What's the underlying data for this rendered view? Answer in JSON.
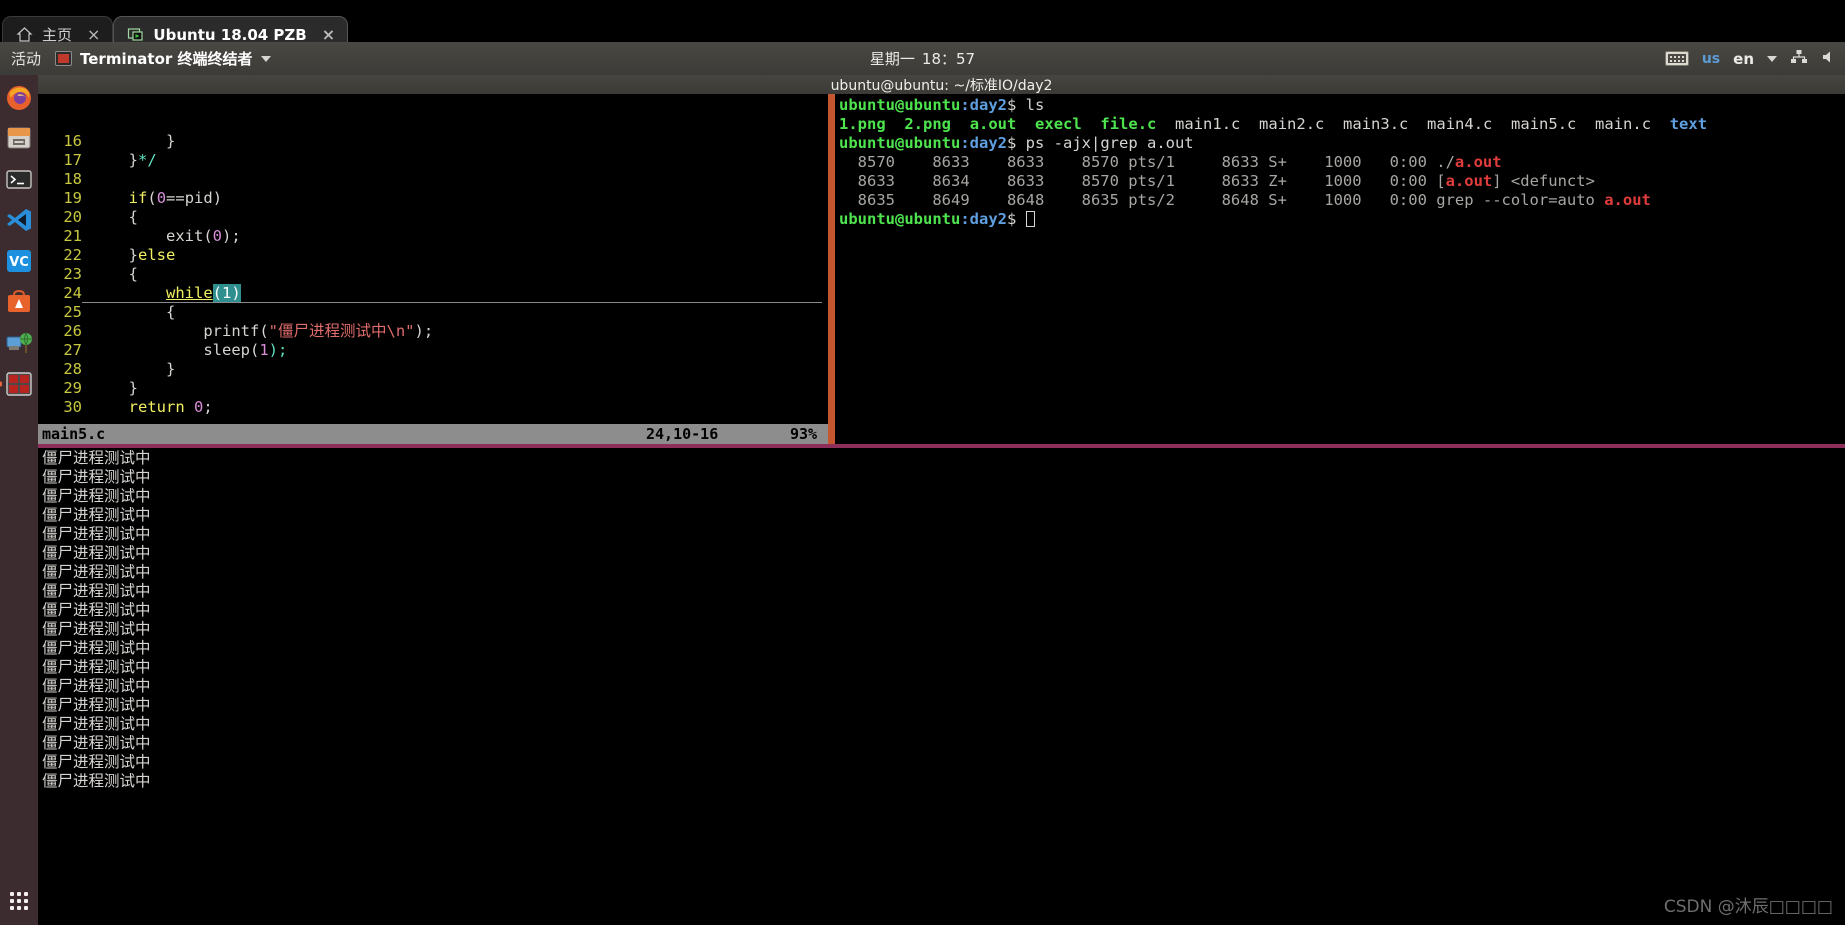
{
  "browser": {
    "tabs": [
      {
        "label": "主页",
        "icon": "home-icon",
        "active": false,
        "close": "×"
      },
      {
        "label": "Ubuntu 18.04 PZB",
        "icon": "vnc-screen-icon",
        "active": true,
        "close": "×"
      }
    ]
  },
  "panel": {
    "activities": "活动",
    "app_menu": "Terminator 终端终结者",
    "app_icon": "terminator-icon",
    "clock_day": "星期一",
    "clock_time": "18：57",
    "keyboard_layout": "us",
    "input_method": "en",
    "icons": [
      "keyboard-icon",
      "network-icon",
      "volume-icon"
    ]
  },
  "dock": {
    "items": [
      {
        "name": "firefox",
        "label": "Firefox",
        "running": false
      },
      {
        "name": "files",
        "label": "Files",
        "running": false
      },
      {
        "name": "terminal",
        "label": "Terminal",
        "running": false
      },
      {
        "name": "vscode",
        "label": "Visual Studio Code",
        "running": false
      },
      {
        "name": "vncviewer",
        "label": "VNC Viewer",
        "running": false
      },
      {
        "name": "software",
        "label": "Ubuntu Software",
        "running": false
      },
      {
        "name": "remmina",
        "label": "Remmina",
        "running": false
      },
      {
        "name": "terminator",
        "label": "Terminator",
        "running": true
      }
    ],
    "show_apps_label": "显示应用程序"
  },
  "window": {
    "title": "ubuntu@ubuntu: ~/标准IO/day2"
  },
  "vim": {
    "lines": [
      {
        "n": "16",
        "segs": [
          {
            "t": "        }",
            "c": "punc"
          }
        ]
      },
      {
        "n": "17",
        "segs": [
          {
            "t": "    }",
            "c": "punc"
          },
          {
            "t": "*/",
            "c": "kw-st"
          }
        ]
      },
      {
        "n": "18",
        "segs": [
          {
            "t": "",
            "c": "punc"
          }
        ]
      },
      {
        "n": "19",
        "segs": [
          {
            "t": "    ",
            "c": "punc"
          },
          {
            "t": "if",
            "c": "kw-ctrl"
          },
          {
            "t": "(",
            "c": "punc"
          },
          {
            "t": "0",
            "c": "num"
          },
          {
            "t": "==pid)",
            "c": "punc"
          }
        ]
      },
      {
        "n": "20",
        "segs": [
          {
            "t": "    {",
            "c": "punc"
          }
        ]
      },
      {
        "n": "21",
        "segs": [
          {
            "t": "        exit(",
            "c": "punc"
          },
          {
            "t": "0",
            "c": "num"
          },
          {
            "t": ");",
            "c": "punc"
          }
        ]
      },
      {
        "n": "22",
        "segs": [
          {
            "t": "    }",
            "c": "punc"
          },
          {
            "t": "else",
            "c": "kw-ctrl"
          }
        ]
      },
      {
        "n": "23",
        "segs": [
          {
            "t": "    {",
            "c": "punc"
          }
        ]
      },
      {
        "n": "24",
        "segs": [
          {
            "t": "        ",
            "c": "punc"
          },
          {
            "t": "while",
            "c": "kw-ctrl kw-under"
          },
          {
            "t": "(",
            "c": "teal-bg"
          },
          {
            "t": "1",
            "c": "teal-bg"
          },
          {
            "t": ")",
            "c": "teal-bg"
          }
        ],
        "cursorline": true
      },
      {
        "n": "25",
        "segs": [
          {
            "t": "        {",
            "c": "punc"
          }
        ]
      },
      {
        "n": "26",
        "segs": [
          {
            "t": "            printf(",
            "c": "punc"
          },
          {
            "t": "\"僵尸进程测试中\\n\"",
            "c": "str"
          },
          {
            "t": ");",
            "c": "punc"
          }
        ]
      },
      {
        "n": "27",
        "segs": [
          {
            "t": "            sleep(",
            "c": "punc"
          },
          {
            "t": "1",
            "c": "num"
          },
          {
            "t": ");",
            "c": "kw-st"
          }
        ]
      },
      {
        "n": "28",
        "segs": [
          {
            "t": "        }",
            "c": "punc"
          }
        ]
      },
      {
        "n": "29",
        "segs": [
          {
            "t": "    }",
            "c": "punc"
          }
        ]
      },
      {
        "n": "30",
        "segs": [
          {
            "t": "    ",
            "c": "punc"
          },
          {
            "t": "return",
            "c": "kw-ctrl"
          },
          {
            "t": " ",
            "c": "punc"
          },
          {
            "t": "0",
            "c": "num"
          },
          {
            "t": ";",
            "c": "punc"
          }
        ]
      }
    ],
    "status": {
      "filename": "main5.c",
      "position": "24,10-16",
      "percent": "93%"
    }
  },
  "shell": {
    "prompt_user": "ubuntu@ubuntu",
    "prompt_path": ":day2",
    "prompt_sym": "$ ",
    "lines": [
      {
        "type": "prompt",
        "cmd": "ls"
      },
      {
        "type": "ls",
        "items": [
          {
            "t": "1.png",
            "c": "t-ls-exec"
          },
          {
            "t": "  ",
            "c": "t-white"
          },
          {
            "t": "2.png",
            "c": "t-ls-exec"
          },
          {
            "t": "  ",
            "c": "t-white"
          },
          {
            "t": "a.out",
            "c": "t-ls-exec"
          },
          {
            "t": "  ",
            "c": "t-white"
          },
          {
            "t": "execl",
            "c": "t-ls-exec"
          },
          {
            "t": "  ",
            "c": "t-white"
          },
          {
            "t": "file.c",
            "c": "t-ls-exec"
          },
          {
            "t": "  ",
            "c": "t-white"
          },
          {
            "t": "main1.c",
            "c": "t-white"
          },
          {
            "t": "  ",
            "c": "t-white"
          },
          {
            "t": "main2.c",
            "c": "t-white"
          },
          {
            "t": "  ",
            "c": "t-white"
          },
          {
            "t": "main3.c",
            "c": "t-white"
          },
          {
            "t": "  ",
            "c": "t-white"
          },
          {
            "t": "main4.c",
            "c": "t-white"
          },
          {
            "t": "  ",
            "c": "t-white"
          },
          {
            "t": "main5.c",
            "c": "t-white"
          },
          {
            "t": "  ",
            "c": "t-white"
          },
          {
            "t": "main.c",
            "c": "t-white"
          },
          {
            "t": "  ",
            "c": "t-white"
          },
          {
            "t": "text",
            "c": "t-ls-dir"
          }
        ]
      },
      {
        "type": "prompt",
        "cmd": "ps -ajx|grep a.out"
      },
      {
        "type": "ps",
        "segs": [
          {
            "t": "  8570    8633    8633    8570 pts/1     8633 S+    1000   0:00 ",
            "c": "t-dim"
          },
          {
            "t": "./",
            "c": "t-dim"
          },
          {
            "t": "a.out",
            "c": "t-red"
          }
        ]
      },
      {
        "type": "ps",
        "segs": [
          {
            "t": "  8633    8634    8633    8570 pts/1     8633 Z+    1000   0:00 [",
            "c": "t-dim"
          },
          {
            "t": "a.out",
            "c": "t-red"
          },
          {
            "t": "] <defunct>",
            "c": "t-dim"
          }
        ]
      },
      {
        "type": "ps",
        "segs": [
          {
            "t": "  8635    8649    8648    8635 pts/2     8648 S+    1000   0:00 grep --color=auto ",
            "c": "t-dim"
          },
          {
            "t": "a.out",
            "c": "t-red"
          }
        ]
      },
      {
        "type": "prompt-cursor",
        "cmd": ""
      }
    ]
  },
  "output": {
    "text": "僵尸进程测试中",
    "count": 18
  },
  "watermark": "CSDN @沐辰□□□□",
  "colors": {
    "dock_bg": "#3c2c30",
    "panel_bg": "#46443f",
    "split_vertical": "#c4572f",
    "split_horizontal": "#8e2f5b",
    "vim_status_bg": "#8d8d8d",
    "accent_orange": "#e8643c"
  }
}
